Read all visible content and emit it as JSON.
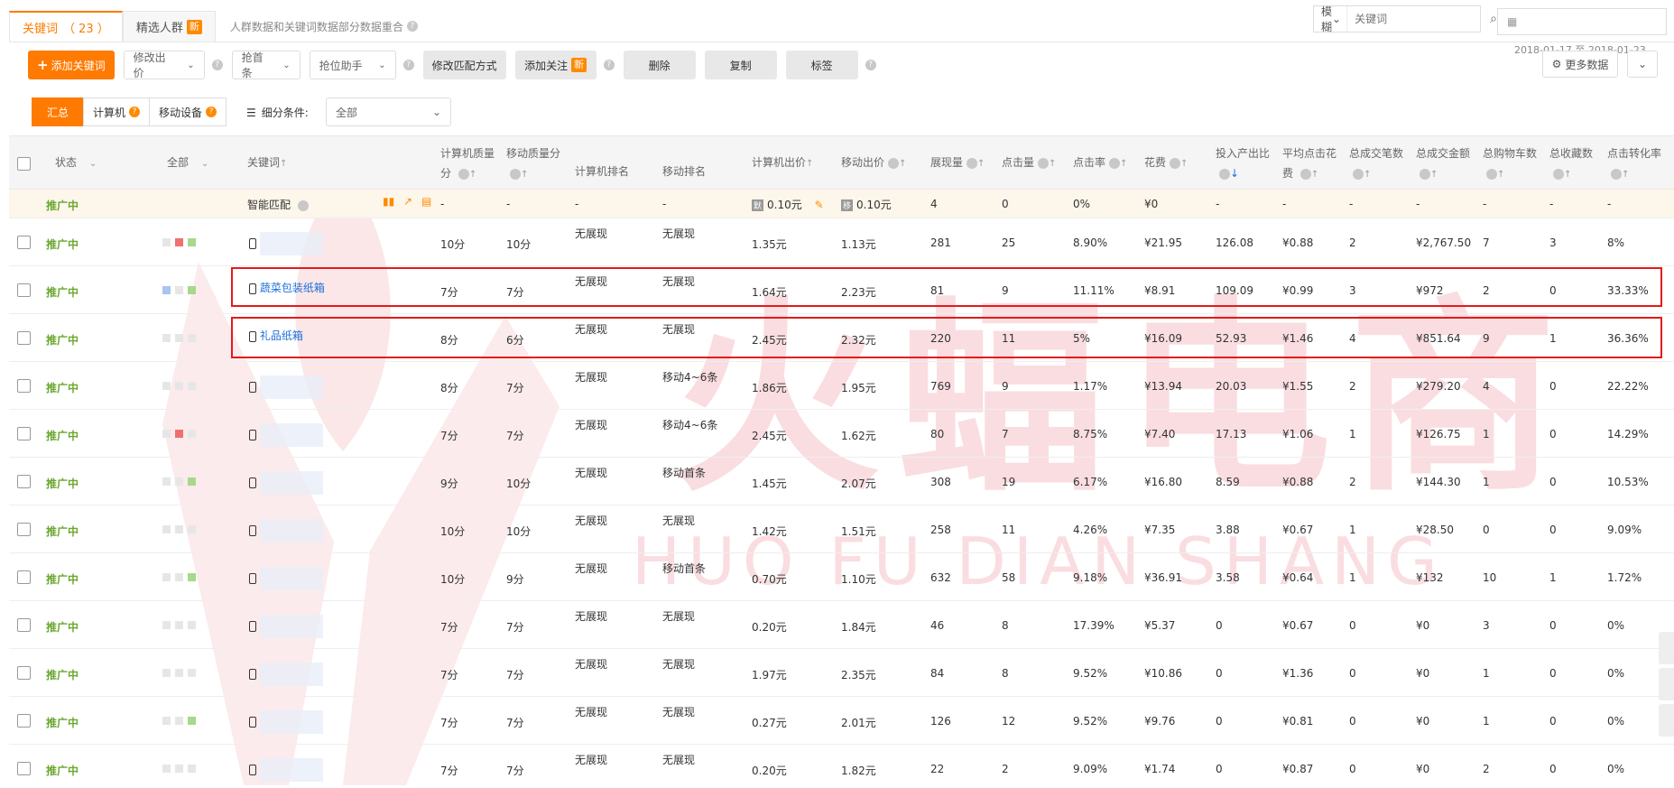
{
  "tabs": [
    {
      "label": "关键词",
      "count": "（ 23 ）"
    },
    {
      "label": "精选人群",
      "badge": "新"
    }
  ],
  "tab_note": "人群数据和关键词数据部分数据重合",
  "search": {
    "mode": "模糊",
    "placeholder": "关键词"
  },
  "date_range": "2018-01-17 至 2018-01-23",
  "toolbar": {
    "add_keyword": "添加关键词",
    "modify_bid": "修改出价",
    "grab_top": "抢首条",
    "rank_helper": "抢位助手",
    "modify_match": "修改匹配方式",
    "add_follow": "添加关注",
    "add_follow_badge": "新",
    "delete": "删除",
    "copy": "复制",
    "tag": "标签",
    "more_data": "更多数据"
  },
  "filter": {
    "segments": [
      "汇总",
      "计算机",
      "移动设备"
    ],
    "label": "细分条件:",
    "value": "全部"
  },
  "columns": {
    "status": "状态",
    "all": "全部",
    "keyword": "关键词",
    "pc_quality": "计算机质量分",
    "mobile_quality": "移动质量分",
    "pc_rank": "计算机排名",
    "mobile_rank": "移动排名",
    "pc_bid": "计算机出价",
    "mobile_bid": "移动出价",
    "impressions": "展现量",
    "clicks": "点击量",
    "ctr": "点击率",
    "cost": "花费",
    "roi": "投入产出比",
    "cpc": "平均点击花费",
    "orders": "总成交笔数",
    "gmv": "总成交金额",
    "cart": "总购物车数",
    "fav": "总收藏数",
    "cvr": "点击转化率"
  },
  "smart_row": {
    "status": "推广中",
    "keyword": "智能匹配",
    "pc_quality": "-",
    "mobile_quality": "-",
    "pc_rank": "-",
    "mobile_rank": "-",
    "pc_bid_tag": "默",
    "pc_bid": "0.10元",
    "mobile_bid_tag": "移",
    "mobile_bid": "0.10元",
    "impressions": "4",
    "clicks": "0",
    "ctr": "0%",
    "cost": "¥0",
    "roi": "-",
    "cpc": "-",
    "orders": "-",
    "gmv": "-",
    "cart": "-",
    "fav": "-",
    "cvr": "-"
  },
  "rows": [
    {
      "status": "推广中",
      "keyword": "",
      "pcq": "10分",
      "mq": "10分",
      "pcr": "无展现",
      "mr": "无展现",
      "pcb": "1.35元",
      "mb": "1.13元",
      "imp": "281",
      "clk": "25",
      "ctr": "8.90%",
      "cost": "¥21.95",
      "roi": "126.08",
      "cpc": "¥0.88",
      "ord": "2",
      "gmv": "¥2,767.50",
      "cart": "7",
      "fav": "3",
      "cvr": "8%"
    },
    {
      "status": "推广中",
      "keyword": "蔬菜包装纸箱",
      "pcq": "7分",
      "mq": "7分",
      "pcr": "无展现",
      "mr": "无展现",
      "pcb": "1.64元",
      "mb": "2.23元",
      "imp": "81",
      "clk": "9",
      "ctr": "11.11%",
      "cost": "¥8.91",
      "roi": "109.09",
      "cpc": "¥0.99",
      "ord": "3",
      "gmv": "¥972",
      "cart": "2",
      "fav": "0",
      "cvr": "33.33%"
    },
    {
      "status": "推广中",
      "keyword": "礼品纸箱",
      "pcq": "8分",
      "mq": "6分",
      "pcr": "无展现",
      "mr": "无展现",
      "pcb": "2.45元",
      "mb": "2.32元",
      "imp": "220",
      "clk": "11",
      "ctr": "5%",
      "cost": "¥16.09",
      "roi": "52.93",
      "cpc": "¥1.46",
      "ord": "4",
      "gmv": "¥851.64",
      "cart": "9",
      "fav": "1",
      "cvr": "36.36%"
    },
    {
      "status": "推广中",
      "keyword": "",
      "pcq": "8分",
      "mq": "7分",
      "pcr": "无展现",
      "mr": "移动4~6条",
      "pcb": "1.86元",
      "mb": "1.95元",
      "imp": "769",
      "clk": "9",
      "ctr": "1.17%",
      "cost": "¥13.94",
      "roi": "20.03",
      "cpc": "¥1.55",
      "ord": "2",
      "gmv": "¥279.20",
      "cart": "4",
      "fav": "0",
      "cvr": "22.22%"
    },
    {
      "status": "推广中",
      "keyword": "",
      "pcq": "7分",
      "mq": "7分",
      "pcr": "无展现",
      "mr": "移动4~6条",
      "pcb": "2.45元",
      "mb": "1.62元",
      "imp": "80",
      "clk": "7",
      "ctr": "8.75%",
      "cost": "¥7.40",
      "roi": "17.13",
      "cpc": "¥1.06",
      "ord": "1",
      "gmv": "¥126.75",
      "cart": "1",
      "fav": "0",
      "cvr": "14.29%"
    },
    {
      "status": "推广中",
      "keyword": "",
      "pcq": "9分",
      "mq": "10分",
      "pcr": "无展现",
      "mr": "移动首条",
      "pcb": "1.45元",
      "mb": "2.07元",
      "imp": "308",
      "clk": "19",
      "ctr": "6.17%",
      "cost": "¥16.80",
      "roi": "8.59",
      "cpc": "¥0.88",
      "ord": "2",
      "gmv": "¥144.30",
      "cart": "1",
      "fav": "0",
      "cvr": "10.53%"
    },
    {
      "status": "推广中",
      "keyword": "",
      "pcq": "10分",
      "mq": "10分",
      "pcr": "无展现",
      "mr": "无展现",
      "pcb": "1.42元",
      "mb": "1.51元",
      "imp": "258",
      "clk": "11",
      "ctr": "4.26%",
      "cost": "¥7.35",
      "roi": "3.88",
      "cpc": "¥0.67",
      "ord": "1",
      "gmv": "¥28.50",
      "cart": "0",
      "fav": "0",
      "cvr": "9.09%"
    },
    {
      "status": "推广中",
      "keyword": "",
      "pcq": "10分",
      "mq": "9分",
      "pcr": "无展现",
      "mr": "移动首条",
      "pcb": "0.70元",
      "mb": "1.10元",
      "imp": "632",
      "clk": "58",
      "ctr": "9.18%",
      "cost": "¥36.91",
      "roi": "3.58",
      "cpc": "¥0.64",
      "ord": "1",
      "gmv": "¥132",
      "cart": "10",
      "fav": "1",
      "cvr": "1.72%"
    },
    {
      "status": "推广中",
      "keyword": "",
      "pcq": "7分",
      "mq": "7分",
      "pcr": "无展现",
      "mr": "无展现",
      "pcb": "0.20元",
      "mb": "1.84元",
      "imp": "46",
      "clk": "8",
      "ctr": "17.39%",
      "cost": "¥5.37",
      "roi": "0",
      "cpc": "¥0.67",
      "ord": "0",
      "gmv": "¥0",
      "cart": "3",
      "fav": "0",
      "cvr": "0%"
    },
    {
      "status": "推广中",
      "keyword": "",
      "pcq": "7分",
      "mq": "7分",
      "pcr": "无展现",
      "mr": "无展现",
      "pcb": "1.97元",
      "mb": "2.35元",
      "imp": "84",
      "clk": "8",
      "ctr": "9.52%",
      "cost": "¥10.86",
      "roi": "0",
      "cpc": "¥1.36",
      "ord": "0",
      "gmv": "¥0",
      "cart": "1",
      "fav": "0",
      "cvr": "0%"
    },
    {
      "status": "推广中",
      "keyword": "",
      "pcq": "7分",
      "mq": "7分",
      "pcr": "无展现",
      "mr": "无展现",
      "pcb": "0.27元",
      "mb": "2.01元",
      "imp": "126",
      "clk": "12",
      "ctr": "9.52%",
      "cost": "¥9.76",
      "roi": "0",
      "cpc": "¥0.81",
      "ord": "0",
      "gmv": "¥0",
      "cart": "1",
      "fav": "0",
      "cvr": "0%"
    },
    {
      "status": "推广中",
      "keyword": "",
      "pcq": "7分",
      "mq": "7分",
      "pcr": "无展现",
      "mr": "无展现",
      "pcb": "0.20元",
      "mb": "1.82元",
      "imp": "22",
      "clk": "2",
      "ctr": "9.09%",
      "cost": "¥1.74",
      "roi": "0",
      "cpc": "¥0.87",
      "ord": "0",
      "gmv": "¥0",
      "cart": "2",
      "fav": "0",
      "cvr": "0%"
    }
  ],
  "watermark": {
    "big": "火蝠电商",
    "latin": "HUO FU DIAN SHANG"
  },
  "colors": {
    "accent": "#ff7a00",
    "status_green": "#6aa82e",
    "link": "#1e6fd9",
    "highlight_box": "#e31b1b"
  }
}
